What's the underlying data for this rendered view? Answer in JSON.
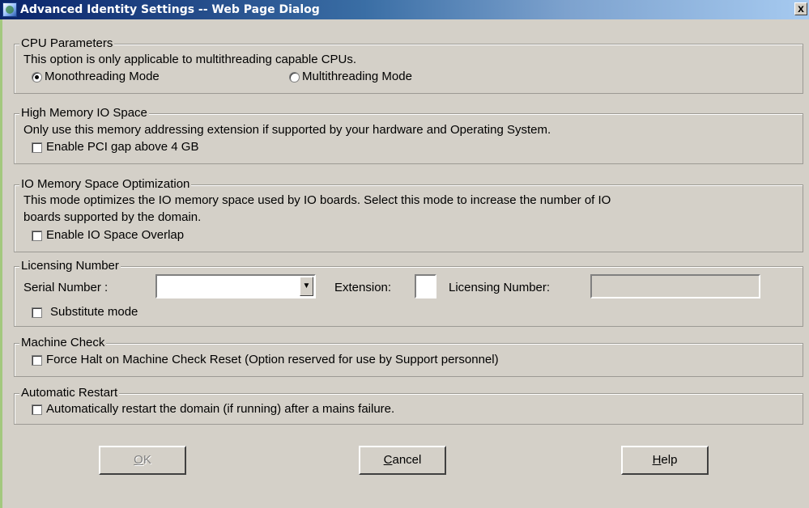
{
  "window": {
    "title": "Advanced Identity Settings -- Web Page Dialog",
    "close_label": "x"
  },
  "cpu": {
    "legend": "CPU Parameters",
    "description": "This option is only applicable to multithreading capable CPUs.",
    "mono_label": "Monothreading Mode",
    "multi_label": "Multithreading Mode",
    "selected": "Monothreading Mode"
  },
  "memory": {
    "legend": "High Memory IO Space",
    "description": "Only use this memory addressing extension if supported by your hardware and Operating System.",
    "checkbox_label": "Enable PCI gap above 4 GB",
    "checked": false
  },
  "io": {
    "legend": "IO Memory Space Optimization",
    "description_line1": "This mode optimizes the IO memory space used by IO boards. Select this mode to increase the number of IO",
    "description_line2": "boards supported by the domain.",
    "checkbox_label": "Enable IO Space Overlap",
    "checked": false
  },
  "licensing": {
    "legend": "Licensing Number",
    "serial_label": "Serial Number :",
    "serial_value": "",
    "extension_label": "Extension:",
    "extension_value": "",
    "licensing_label": "Licensing Number:",
    "licensing_value": "",
    "substitute_label": "Substitute mode",
    "substitute_checked": false
  },
  "machine_check": {
    "legend": "Machine Check",
    "checkbox_label": "Force Halt on Machine Check Reset (Option reserved for use by Support personnel)",
    "checked": false
  },
  "restart": {
    "legend": "Automatic Restart",
    "checkbox_label": "Automatically restart the domain (if running) after a mains failure.",
    "checked": false
  },
  "buttons": {
    "ok_first": "O",
    "ok_rest": "K",
    "cancel_first": "C",
    "cancel_rest": "ancel",
    "help_first": "H",
    "help_rest": "elp"
  }
}
